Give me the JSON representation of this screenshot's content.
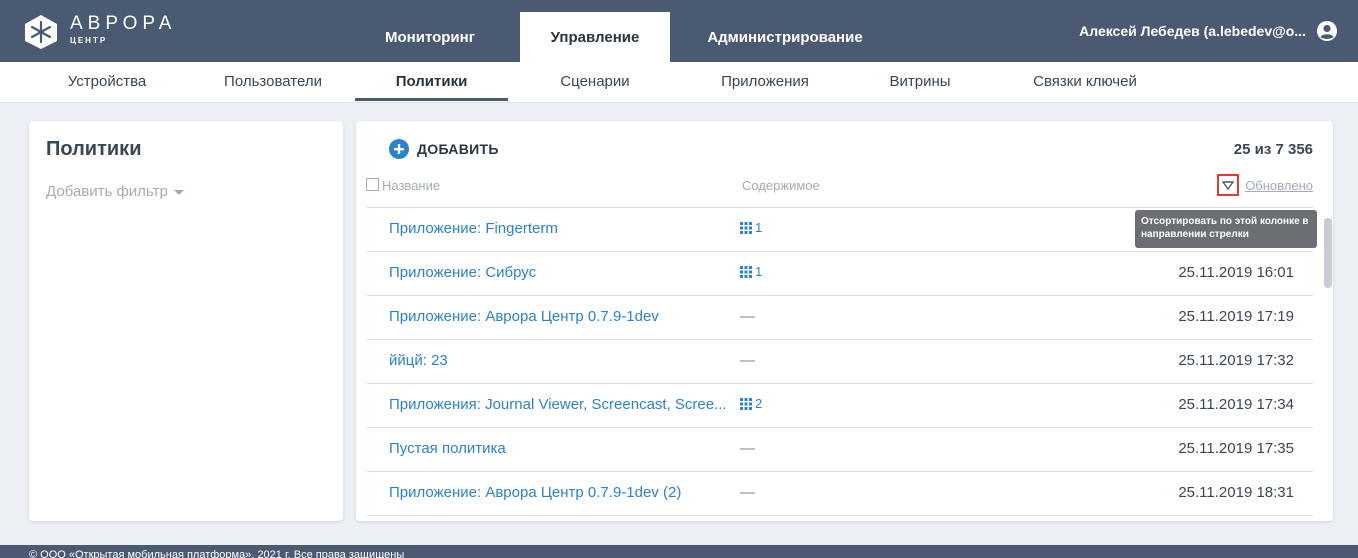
{
  "header": {
    "logo_title": "АВРОРА",
    "logo_subtitle": "ЦЕНТР",
    "tabs": [
      {
        "label": "Мониторинг"
      },
      {
        "label": "Управление"
      },
      {
        "label": "Администрирование"
      }
    ],
    "user": "Алексей Лебедев (a.lebedev@o..."
  },
  "subnav": {
    "items": [
      {
        "label": "Устройства"
      },
      {
        "label": "Пользователи"
      },
      {
        "label": "Политики"
      },
      {
        "label": "Сценарии"
      },
      {
        "label": "Приложения"
      },
      {
        "label": "Витрины"
      },
      {
        "label": "Связки ключей"
      }
    ]
  },
  "left": {
    "title": "Политики",
    "filter_label": "Добавить фильтр"
  },
  "main": {
    "add_label": "ДОБАВИТЬ",
    "count": "25 из 7 356",
    "columns": {
      "name": "Название",
      "content": "Содержимое",
      "updated": "Обновлено"
    },
    "tooltip": "Отсортировать по этой колонке в направлении стрелки",
    "rows": [
      {
        "name": "Приложение: Fingerterm",
        "content": "1",
        "date": ""
      },
      {
        "name": "Приложение: Сибрус",
        "content": "1",
        "date": "25.11.2019 16:01"
      },
      {
        "name": "Приложение: Аврора Центр 0.7.9-1dev",
        "content": "—",
        "date": "25.11.2019 17:19"
      },
      {
        "name": "ййцй: 23",
        "content": "—",
        "date": "25.11.2019 17:32"
      },
      {
        "name": "Приложения: Journal Viewer, Screencast, Scree...",
        "content": "2",
        "date": "25.11.2019 17:34"
      },
      {
        "name": "Пустая политика",
        "content": "—",
        "date": "25.11.2019 17:35"
      },
      {
        "name": "Приложение: Аврора Центр 0.7.9-1dev (2)",
        "content": "—",
        "date": "25.11.2019 18:31"
      }
    ]
  },
  "footer": {
    "text": "© ООО «Открытая мобильная платформа», 2021 г. Все права защищены"
  },
  "colors": {
    "header_bg": "#4a5a72",
    "link": "#2d82c8",
    "highlight": "#e53935"
  }
}
